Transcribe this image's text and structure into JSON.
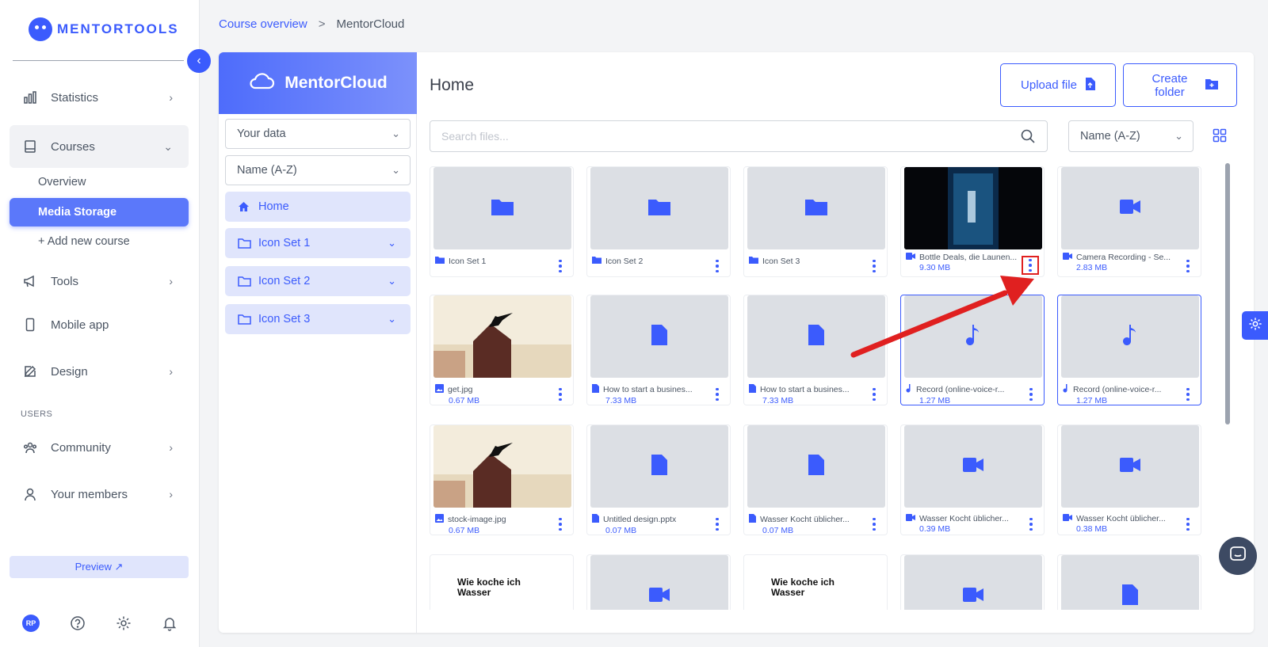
{
  "app": {
    "brand": "MENTORTOOLS"
  },
  "sidebar": {
    "items": [
      {
        "label": "Statistics",
        "icon": "bar-chart-icon"
      },
      {
        "label": "Courses",
        "icon": "book-icon"
      },
      {
        "label": "Tools",
        "icon": "megaphone-icon"
      },
      {
        "label": "Mobile app",
        "icon": "phone-icon"
      },
      {
        "label": "Design",
        "icon": "pencil-icon"
      },
      {
        "label": "Community",
        "icon": "people-icon"
      },
      {
        "label": "Your members",
        "icon": "user-icon"
      }
    ],
    "sub_items": {
      "overview": "Overview",
      "media_storage": "Media Storage",
      "add_course": "+ Add new course"
    },
    "users_section": "USERS",
    "preview": "Preview ↗",
    "avatar_initials": "RP"
  },
  "breadcrumb": {
    "link": "Course overview",
    "separator": ">",
    "current": "MentorCloud"
  },
  "cloud": {
    "title": "MentorCloud",
    "data_select": "Your data",
    "sort_select": "Name (A-Z)",
    "tree": [
      {
        "label": "Home"
      },
      {
        "label": "Icon Set 1"
      },
      {
        "label": "Icon Set 2"
      },
      {
        "label": "Icon Set 3"
      }
    ]
  },
  "content": {
    "title": "Home",
    "upload_label": "Upload file",
    "create_folder_label": "Create folder",
    "search_placeholder": "Search files...",
    "sort_value": "Name (A-Z)"
  },
  "files": [
    {
      "name": "Icon Set 1",
      "size": "",
      "type": "folder"
    },
    {
      "name": "Icon Set 2",
      "size": "",
      "type": "folder"
    },
    {
      "name": "Icon Set 3",
      "size": "",
      "type": "folder"
    },
    {
      "name": "Bottle Deals, die Launen...",
      "size": "9.30 MB",
      "type": "video"
    },
    {
      "name": "Camera Recording - Se...",
      "size": "2.83 MB",
      "type": "video"
    },
    {
      "name": "get.jpg",
      "size": "0.67 MB",
      "type": "image"
    },
    {
      "name": "How to start a busines...",
      "size": "7.33 MB",
      "type": "document"
    },
    {
      "name": "How to start a busines...",
      "size": "7.33 MB",
      "type": "document"
    },
    {
      "name": "Record (online-voice-r...",
      "size": "1.27 MB",
      "type": "audio"
    },
    {
      "name": "Record (online-voice-r...",
      "size": "1.27 MB",
      "type": "audio"
    },
    {
      "name": "stock-image.jpg",
      "size": "0.67 MB",
      "type": "image"
    },
    {
      "name": "Untitled design.pptx",
      "size": "0.07 MB",
      "type": "document"
    },
    {
      "name": "Wasser Kocht üblicher...",
      "size": "0.07 MB",
      "type": "document"
    },
    {
      "name": "Wasser Kocht üblicher...",
      "size": "0.39 MB",
      "type": "video"
    },
    {
      "name": "Wasser Kocht üblicher...",
      "size": "0.38 MB",
      "type": "video"
    }
  ],
  "partial_row": {
    "text_thumb": "Wie koche ich Wasser"
  },
  "colors": {
    "accent": "#3b5bfd",
    "highlight": "#e02020"
  }
}
